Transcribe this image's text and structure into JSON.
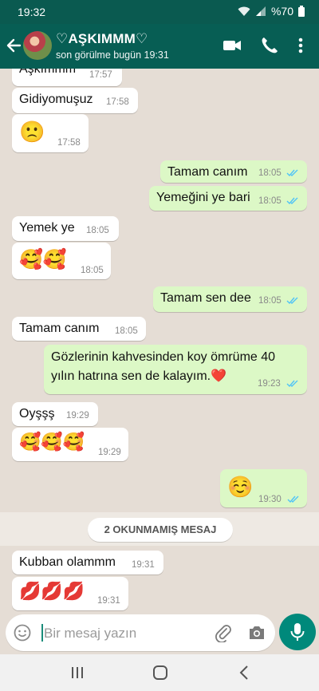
{
  "status_bar": {
    "time": "19:32",
    "battery": "%70"
  },
  "header": {
    "contact_name": "♡AŞKIMMM♡",
    "last_seen": "son görülme bugün 19:31",
    "icons": [
      "back-arrow-icon",
      "avatar",
      "video-call-icon",
      "phone-icon",
      "more-vert-icon"
    ]
  },
  "messages": [
    {
      "dir": "in",
      "text": "Aşkımmm",
      "time": "17:57"
    },
    {
      "dir": "in",
      "text": "Gidiyomuşuz",
      "time": "17:58"
    },
    {
      "dir": "in",
      "text": "🙁",
      "time": "17:58"
    },
    {
      "dir": "out",
      "text": "Tamam canım",
      "time": "18:05",
      "read": true
    },
    {
      "dir": "out",
      "text": "Yemeğini ye bari",
      "time": "18:05",
      "read": true
    },
    {
      "dir": "in",
      "text": "Yemek ye",
      "time": "18:05"
    },
    {
      "dir": "in",
      "text": "🥰🥰",
      "time": "18:05"
    },
    {
      "dir": "out",
      "text": "Tamam sen dee",
      "time": "18:05",
      "read": true
    },
    {
      "dir": "in",
      "text": "Tamam canım",
      "time": "18:05"
    },
    {
      "dir": "out",
      "text": "Gözlerinin kahvesinden koy ömrüme 40 yılın hatrına sen de kalayım.❤️",
      "time": "19:23",
      "read": true
    },
    {
      "dir": "in",
      "text": "Oyşşş",
      "time": "19:29"
    },
    {
      "dir": "in",
      "text": "🥰🥰🥰",
      "time": "19:29"
    },
    {
      "dir": "out",
      "text": "☺️",
      "time": "19:30",
      "read": true
    },
    {
      "dir": "in",
      "text": "Kubban olammm",
      "time": "19:31"
    },
    {
      "dir": "in",
      "text": "💋💋💋",
      "time": "19:31"
    }
  ],
  "unread_banner": "2 OKUNMAMIŞ MESAJ",
  "composer": {
    "placeholder": "Bir mesaj yazın"
  },
  "colors": {
    "header": "#075e54",
    "status_bar": "#0a5a50",
    "outgoing": "#dcf8c6",
    "incoming": "#ffffff",
    "chat_bg": "#e5ddd5",
    "tick_read": "#4fc3f7",
    "mic": "#00897b"
  }
}
